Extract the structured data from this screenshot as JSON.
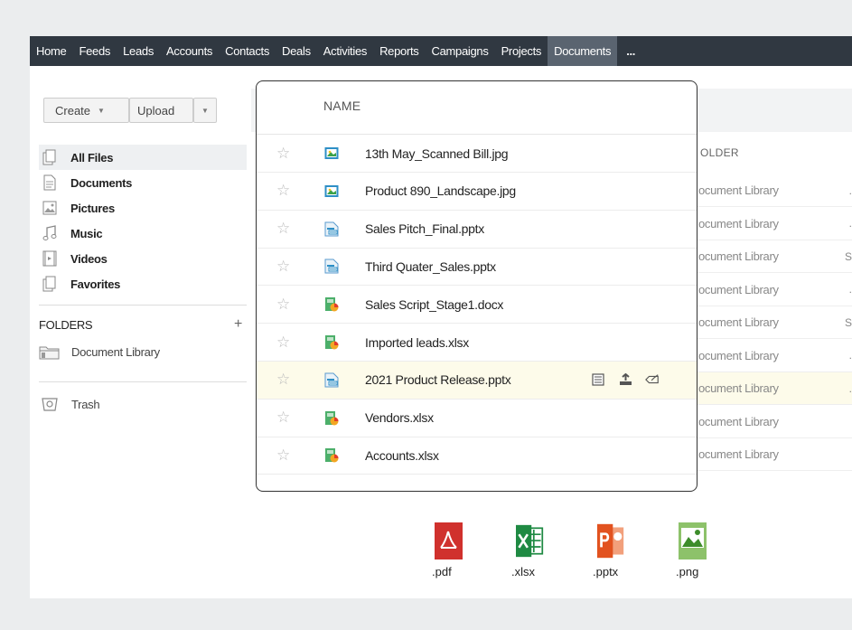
{
  "nav": {
    "items": [
      "Home",
      "Feeds",
      "Leads",
      "Accounts",
      "Contacts",
      "Deals",
      "Activities",
      "Reports",
      "Campaigns",
      "Projects",
      "Documents",
      "..."
    ],
    "active": "Documents"
  },
  "sidebar": {
    "create_label": "Create",
    "upload_label": "Upload",
    "items": [
      {
        "label": "All Files",
        "icon": "files-icon",
        "active": true
      },
      {
        "label": "Documents",
        "icon": "document-icon"
      },
      {
        "label": "Pictures",
        "icon": "picture-icon"
      },
      {
        "label": "Music",
        "icon": "music-icon"
      },
      {
        "label": "Videos",
        "icon": "video-icon"
      },
      {
        "label": "Favorites",
        "icon": "favorites-icon"
      }
    ],
    "folders_label": "FOLDERS",
    "folders_add": "+",
    "document_library": "Document Library",
    "trash": "Trash"
  },
  "background_table": {
    "folder_header": "OLDER",
    "rows": [
      {
        "folder": "ocument Library",
        "trail": "."
      },
      {
        "folder": "ocument Library",
        "trail": "."
      },
      {
        "folder": "ocument Library",
        "trail": "S"
      },
      {
        "folder": "ocument Library",
        "trail": "."
      },
      {
        "folder": "ocument Library",
        "trail": "S"
      },
      {
        "folder": "ocument Library",
        "trail": "."
      },
      {
        "folder": "ocument Library",
        "trail": ".",
        "highlight": true
      },
      {
        "folder": "ocument Library",
        "trail": ""
      },
      {
        "folder": "ocument Library",
        "trail": ""
      }
    ]
  },
  "files": {
    "header": "NAME",
    "rows": [
      {
        "name": "13th May_Scanned Bill.jpg",
        "type": "image"
      },
      {
        "name": "Product 890_Landscape.jpg",
        "type": "image"
      },
      {
        "name": "Sales Pitch_Final.pptx",
        "type": "presentation"
      },
      {
        "name": "Third Quater_Sales.pptx",
        "type": "presentation"
      },
      {
        "name": "Sales Script_Stage1.docx",
        "type": "spreadsheet"
      },
      {
        "name": "Imported leads.xlsx",
        "type": "spreadsheet"
      },
      {
        "name": "2021 Product Release.pptx",
        "type": "presentation",
        "highlight": true,
        "actions": [
          "details-icon",
          "share-icon",
          "tag-icon"
        ]
      },
      {
        "name": "Vendors.xlsx",
        "type": "spreadsheet"
      },
      {
        "name": "Accounts.xlsx",
        "type": "spreadsheet"
      }
    ]
  },
  "file_types": [
    {
      "ext": ".pdf",
      "icon": "pdf-icon",
      "color": "#d0312d"
    },
    {
      "ext": ".xlsx",
      "icon": "excel-icon",
      "color": "#1f8a43"
    },
    {
      "ext": ".pptx",
      "icon": "powerpoint-icon",
      "color": "#e2521f"
    },
    {
      "ext": ".png",
      "icon": "image-icon",
      "color": "#6fb844"
    }
  ]
}
